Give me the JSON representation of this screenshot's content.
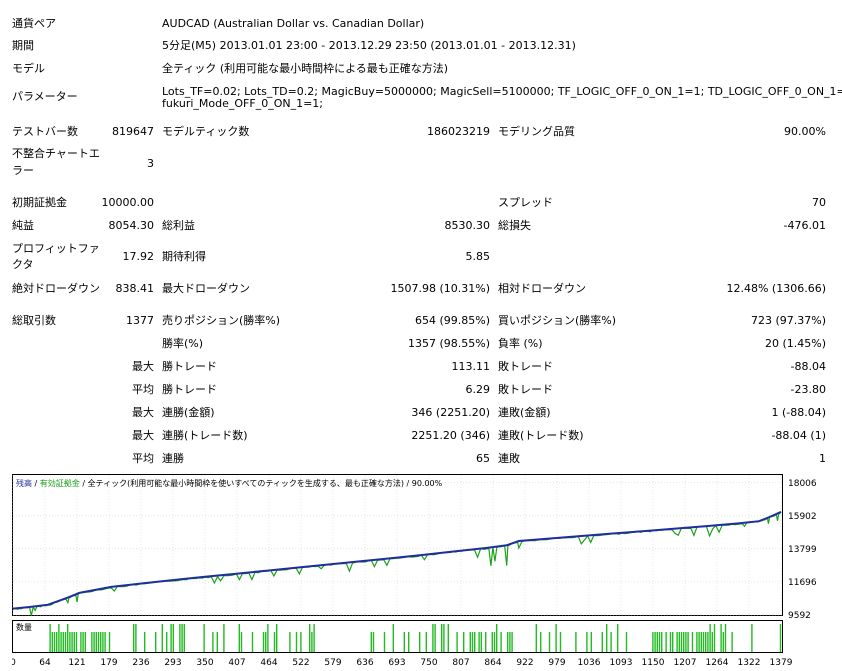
{
  "header": {
    "symbol_label": "通貨ペア",
    "symbol_value": "AUDCAD (Australian Dollar vs. Canadian Dollar)",
    "period_label": "期間",
    "period_value": "5分足(M5) 2013.01.01 23:00 - 2013.12.29 23:50 (2013.01.01 - 2013.12.31)",
    "model_label": "モデル",
    "model_value": "全ティック (利用可能な最小時間枠による最も正確な方法)",
    "params_label": "パラメーター",
    "params_line1": "Lots_TF=0.02; Lots_TD=0.2; MagicBuy=5000000; MagicSell=5100000; TF_LOGIC_OFF_0_ON_1=1; TD_LOGIC_OFF_0_ON_1=1;",
    "params_line2": "fukuri_Mode_OFF_0_ON_1=1;"
  },
  "stats": {
    "bars_label": "テストバー数",
    "bars_value": "819647",
    "ticks_label": "モデルティック数",
    "ticks_value": "186023219",
    "quality_label": "モデリング品質",
    "quality_value": "90.00%",
    "mismatch_label_1": "不整合チャートエ",
    "mismatch_label_2": "ラー",
    "mismatch_value": "3",
    "deposit_label": "初期証拠金",
    "deposit_value": "10000.00",
    "spread_label": "スプレッド",
    "spread_value": "70",
    "net_label": "純益",
    "net_value": "8054.30",
    "gross_profit_label": "総利益",
    "gross_profit_value": "8530.30",
    "gross_loss_label": "総損失",
    "gross_loss_value": "-476.01",
    "pf_label_1": "プロフィットファ",
    "pf_label_2": "クタ",
    "pf_value": "17.92",
    "expected_label": "期待利得",
    "expected_value": "5.85",
    "abs_dd_label": "絶対ドローダウン",
    "abs_dd_value": "838.41",
    "max_dd_label": "最大ドローダウン",
    "max_dd_value": "1507.98 (10.31%)",
    "rel_dd_label": "相対ドローダウン",
    "rel_dd_value": "12.48% (1306.66)",
    "trades_label": "総取引数",
    "trades_value": "1377",
    "short_label": "売りポジション(勝率%)",
    "short_value": "654 (99.85%)",
    "long_label": "買いポジション(勝率%)",
    "long_value": "723 (97.37%)",
    "win_pct_label": "勝率(%)",
    "win_pct_value": "1357 (98.55%)",
    "loss_pct_label": "負率 (%)",
    "loss_pct_value": "20 (1.45%)",
    "max_word": "最大",
    "avg_word": "平均",
    "largest_win_label": "勝トレード",
    "largest_win_value": "113.11",
    "largest_loss_label": "敗トレード",
    "largest_loss_value": "-88.04",
    "avg_win_label": "勝トレード",
    "avg_win_value": "6.29",
    "avg_loss_label": "敗トレード",
    "avg_loss_value": "-23.80",
    "max_cons_wins_label": "連勝(金額)",
    "max_cons_wins_value": "346 (2251.20)",
    "max_cons_losses_label": "連敗(金額)",
    "max_cons_losses_value": "1 (-88.04)",
    "max_cons_profit_label": "連勝(トレード数)",
    "max_cons_profit_value": "2251.20 (346)",
    "max_cons_loss_label": "連敗(トレード数)",
    "max_cons_loss_value": "-88.04 (1)",
    "avg_cons_wins_label": "連勝",
    "avg_cons_wins_value": "65",
    "avg_cons_losses_label": "連敗",
    "avg_cons_losses_value": "1"
  },
  "chart_data": {
    "type": "line",
    "legend_balance": "残高",
    "legend_separator": " / ",
    "legend_equity": "有効証拠金",
    "legend_rest": " / 全ティック(利用可能な最小時間枠を使いすべてのティックを生成する、最も正確な方法) / 90.00%",
    "volume_label": "数量",
    "ylim": [
      9592,
      18500
    ],
    "y_ticks": [
      "18006",
      "15902",
      "13799",
      "11696",
      "9592"
    ],
    "y_tick_values": [
      18006,
      15902,
      13799,
      11696,
      9592
    ],
    "x_ticks": [
      "0",
      "64",
      "121",
      "179",
      "236",
      "293",
      "350",
      "407",
      "464",
      "522",
      "579",
      "636",
      "693",
      "750",
      "807",
      "864",
      "922",
      "979",
      "1036",
      "1093",
      "1150",
      "1207",
      "1264",
      "1322",
      "1379"
    ],
    "xlim": [
      0,
      1400
    ],
    "colors": {
      "balance": "#1f2d9e",
      "equity": "#1aa31a",
      "volume": "#22bb22",
      "grid": "#c8c8c8"
    },
    "balance": [
      [
        0,
        10000
      ],
      [
        30,
        10100
      ],
      [
        64,
        10250
      ],
      [
        100,
        10700
      ],
      [
        121,
        11000
      ],
      [
        179,
        11380
      ],
      [
        236,
        11600
      ],
      [
        293,
        11820
      ],
      [
        350,
        12020
      ],
      [
        407,
        12220
      ],
      [
        464,
        12420
      ],
      [
        522,
        12620
      ],
      [
        579,
        12820
      ],
      [
        636,
        13020
      ],
      [
        693,
        13220
      ],
      [
        750,
        13430
      ],
      [
        807,
        13650
      ],
      [
        864,
        13860
      ],
      [
        900,
        14030
      ],
      [
        922,
        14300
      ],
      [
        979,
        14460
      ],
      [
        1036,
        14620
      ],
      [
        1093,
        14780
      ],
      [
        1150,
        14930
      ],
      [
        1207,
        15090
      ],
      [
        1264,
        15250
      ],
      [
        1322,
        15420
      ],
      [
        1360,
        15560
      ],
      [
        1379,
        15830
      ],
      [
        1400,
        16150
      ]
    ]
  }
}
